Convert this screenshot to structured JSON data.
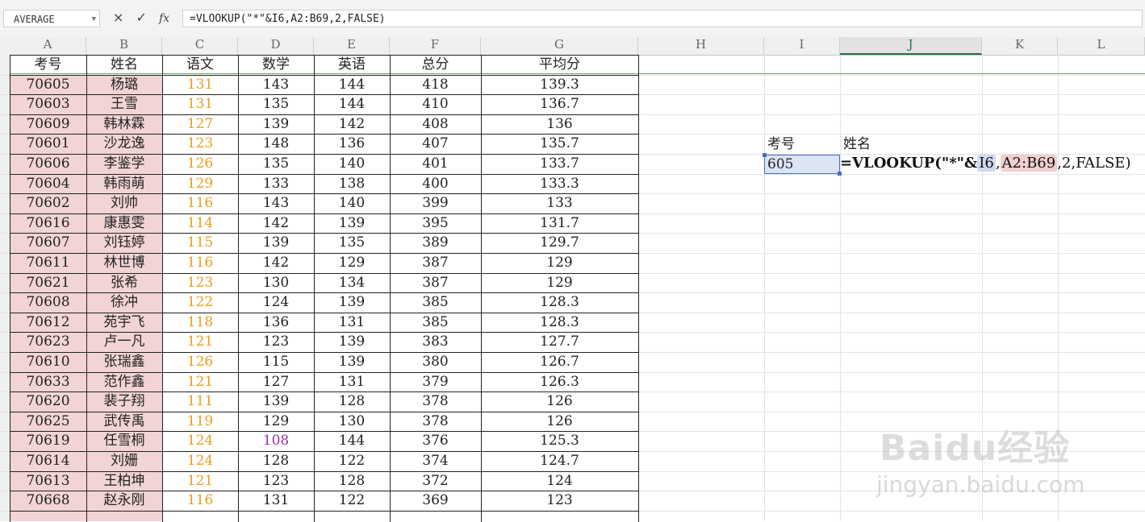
{
  "formula_bar": {
    "name_box": "AVERAGE",
    "cancel_icon": "×",
    "enter_icon": "✓",
    "fx_label": "fx",
    "formula": "=VLOOKUP(\"*\"&I6,A2:B69,2,FALSE)"
  },
  "columns": [
    "A",
    "B",
    "C",
    "D",
    "E",
    "F",
    "G",
    "H",
    "I",
    "J",
    "K",
    "L"
  ],
  "table": {
    "headers": [
      "考号",
      "姓名",
      "语文",
      "数学",
      "英语",
      "总分",
      "平均分"
    ],
    "rows": [
      [
        "70605",
        "杨璐",
        "131",
        "143",
        "144",
        "418",
        "139.3"
      ],
      [
        "70603",
        "王雪",
        "131",
        "135",
        "144",
        "410",
        "136.7"
      ],
      [
        "70609",
        "韩林霖",
        "127",
        "139",
        "142",
        "408",
        "136"
      ],
      [
        "70601",
        "沙龙逸",
        "123",
        "148",
        "136",
        "407",
        "135.7"
      ],
      [
        "70606",
        "李鉴学",
        "126",
        "135",
        "140",
        "401",
        "133.7"
      ],
      [
        "70604",
        "韩雨萌",
        "129",
        "133",
        "138",
        "400",
        "133.3"
      ],
      [
        "70602",
        "刘帅",
        "116",
        "143",
        "140",
        "399",
        "133"
      ],
      [
        "70616",
        "康惠雯",
        "114",
        "142",
        "139",
        "395",
        "131.7"
      ],
      [
        "70607",
        "刘钰婷",
        "115",
        "139",
        "135",
        "389",
        "129.7"
      ],
      [
        "70611",
        "林世博",
        "116",
        "142",
        "129",
        "387",
        "129"
      ],
      [
        "70621",
        "张希",
        "123",
        "130",
        "134",
        "387",
        "129"
      ],
      [
        "70608",
        "徐冲",
        "122",
        "124",
        "139",
        "385",
        "128.3"
      ],
      [
        "70612",
        "苑宇飞",
        "118",
        "136",
        "131",
        "385",
        "128.3"
      ],
      [
        "70623",
        "卢一凡",
        "121",
        "123",
        "139",
        "383",
        "127.7"
      ],
      [
        "70610",
        "张瑞鑫",
        "126",
        "115",
        "139",
        "380",
        "126.7"
      ],
      [
        "70633",
        "范作鑫",
        "121",
        "127",
        "131",
        "379",
        "126.3"
      ],
      [
        "70620",
        "裴子翔",
        "111",
        "139",
        "128",
        "378",
        "126"
      ],
      [
        "70625",
        "武传禹",
        "119",
        "129",
        "130",
        "378",
        "126"
      ],
      [
        "70619",
        "任雪桐",
        "124",
        "108",
        "144",
        "376",
        "125.3"
      ],
      [
        "70614",
        "刘姗",
        "124",
        "128",
        "122",
        "374",
        "124.7"
      ],
      [
        "70613",
        "王柏坤",
        "121",
        "123",
        "128",
        "372",
        "124"
      ],
      [
        "70668",
        "赵永刚",
        "116",
        "131",
        "122",
        "369",
        "123"
      ]
    ]
  },
  "lookup": {
    "id_header": "考号",
    "name_header": "姓名",
    "id_value": "605",
    "formula_prefix": "=VLOOKUP(\"*\"&",
    "ref1": "I6",
    "sep": ",",
    "ref2": "A2:B69",
    "suffix": ",2,FALSE)"
  },
  "colors": {
    "chinese_score": "#e8a020",
    "low_score": "#9b30b0",
    "key_fill": "#f2d4d4"
  },
  "watermark": {
    "logo": "Baidu经验",
    "url": "jingyan.baidu.com"
  }
}
